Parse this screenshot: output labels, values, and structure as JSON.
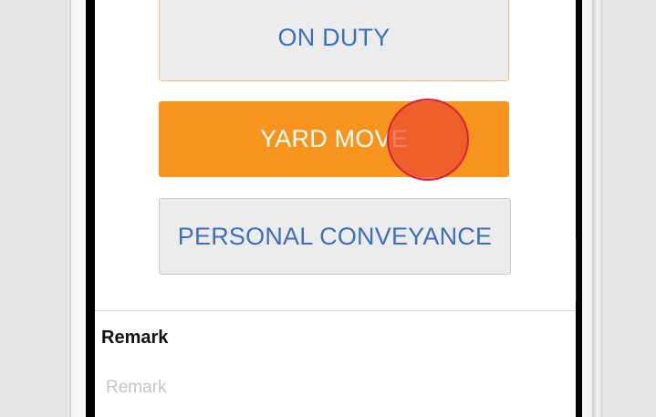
{
  "status_buttons": {
    "on_duty": "ON DUTY",
    "yard_move": "YARD MOVE",
    "personal_conveyance": "PERSONAL CONVEYANCE"
  },
  "remark": {
    "label": "Remark",
    "placeholder": "Remark",
    "value": ""
  },
  "colors": {
    "accent_orange": "#f7941d",
    "button_text_blue": "#3b6fbf",
    "button_gray": "#ececec",
    "touch_indicator_red": "#d8203a"
  }
}
